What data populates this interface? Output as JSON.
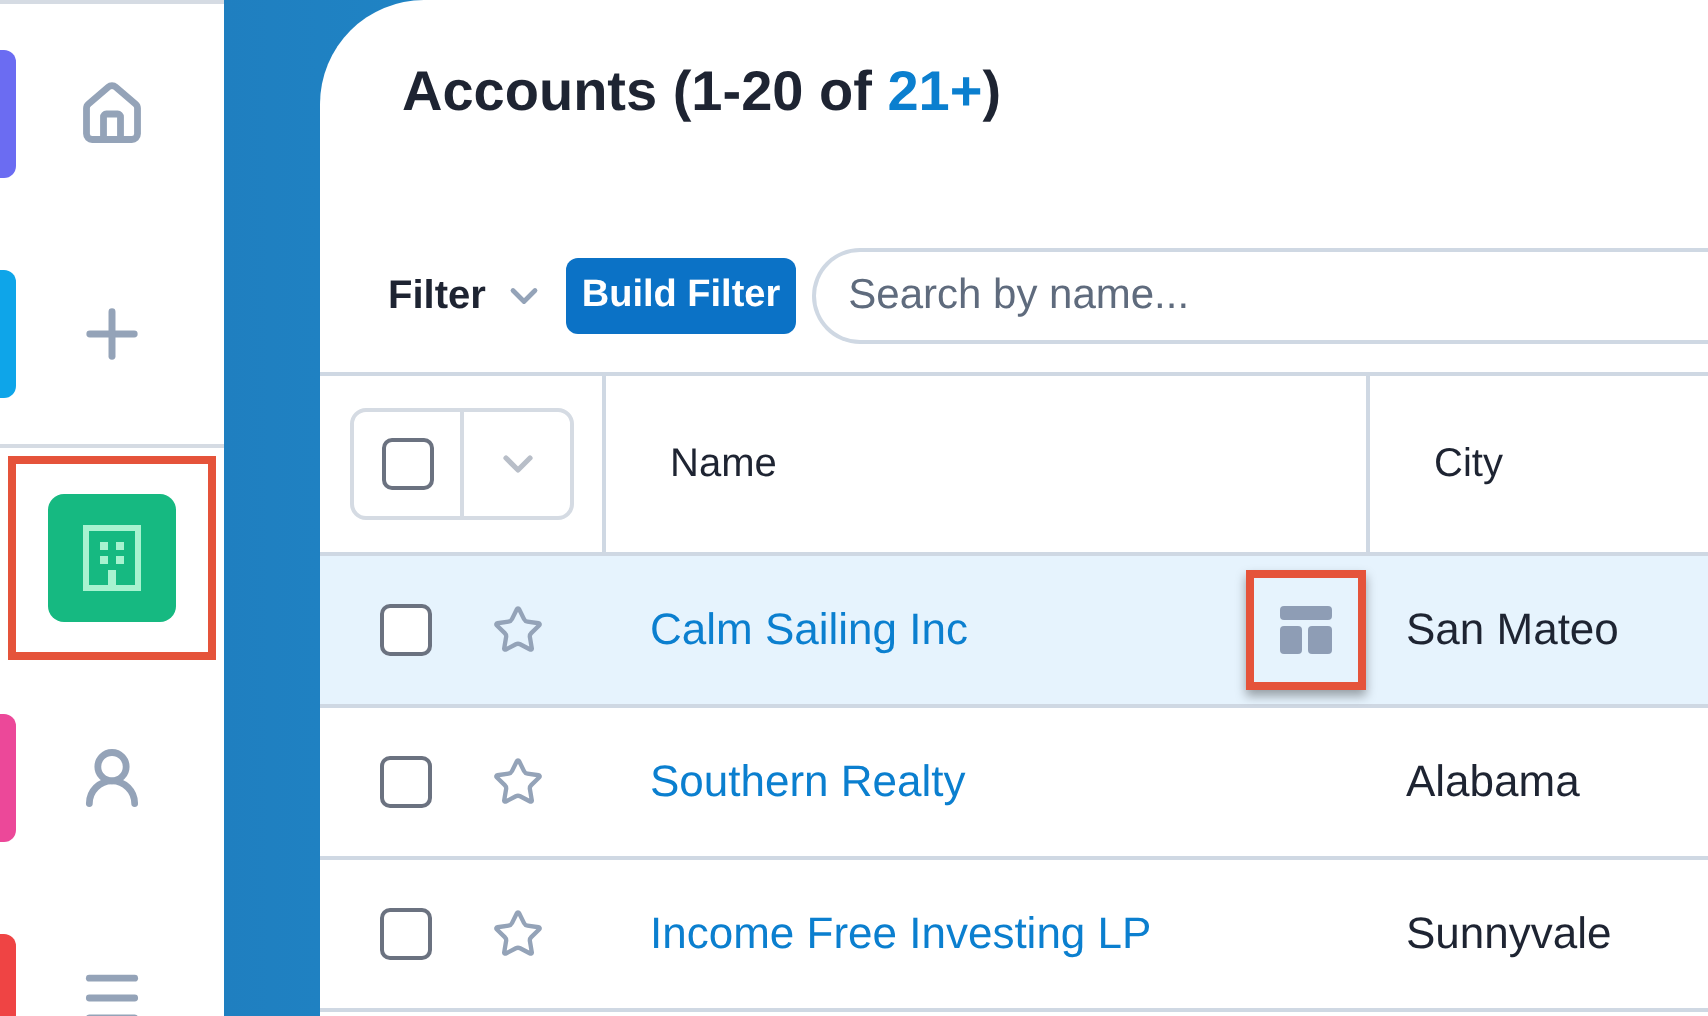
{
  "sidebar": {
    "items": [
      {
        "kind": "home",
        "color": "#6b6cf2",
        "selected": false
      },
      {
        "kind": "create",
        "color": "#0ea5e9",
        "selected": false
      },
      {
        "kind": "divider"
      },
      {
        "kind": "accounts",
        "color": "#16b981",
        "selected": true,
        "annotated": true
      },
      {
        "kind": "contacts",
        "color": "#ec4899",
        "selected": false
      },
      {
        "kind": "menu",
        "color": "#ef4444",
        "selected": false
      }
    ]
  },
  "header": {
    "title": "Accounts (1-20 of ",
    "count": "21+",
    "count_suffix": ")"
  },
  "filter": {
    "label": "Filter",
    "button": "Build Filter",
    "search": {
      "placeholder": "Search by name..."
    }
  },
  "table": {
    "select_all": {
      "checked": false
    },
    "columns": [
      "Name",
      "City"
    ],
    "rows": [
      {
        "name": "Calm Sailing Inc",
        "city": "San Mateo",
        "checked": false,
        "starred": false,
        "selected": true,
        "annotated": true
      },
      {
        "name": "Southern Realty",
        "city": "Alabama",
        "checked": false,
        "starred": false,
        "selected": false,
        "annotated": false
      },
      {
        "name": "Income Free Investing LP",
        "city": "Sunnyvale",
        "checked": false,
        "starred": false,
        "selected": false,
        "annotated": false
      }
    ]
  }
}
